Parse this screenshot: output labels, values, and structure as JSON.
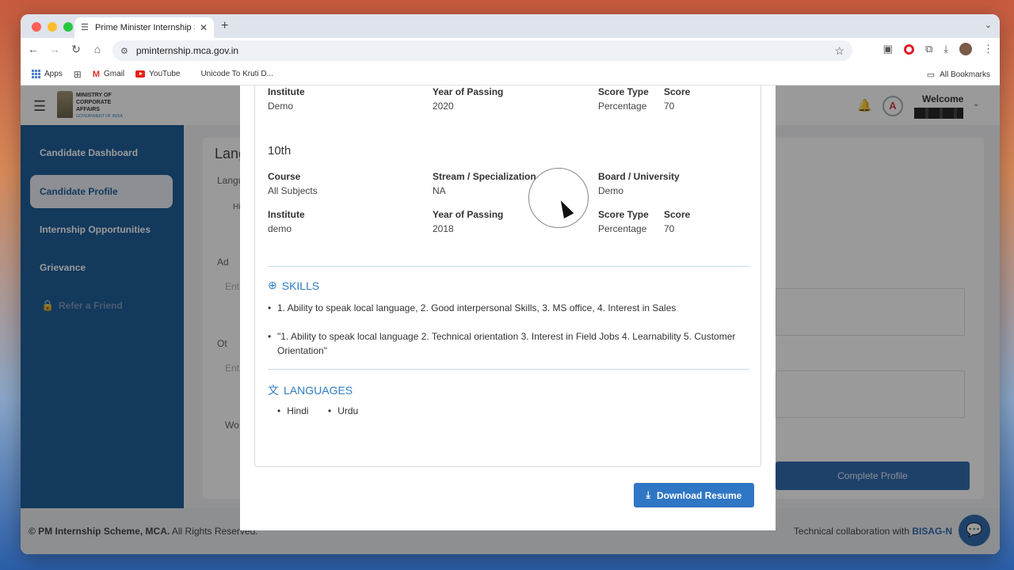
{
  "browser": {
    "tab_title": "Prime Minister Internship Sch",
    "new_tab": "+",
    "url": "pminternship.mca.gov.in",
    "bookmarks": [
      "Apps",
      "Gmail",
      "YouTube",
      "Unicode To Kruti D..."
    ],
    "all_bookmarks": "All Bookmarks"
  },
  "header": {
    "ministry_line1": "MINISTRY OF",
    "ministry_line2": "CORPORATE",
    "ministry_line3": "AFFAIRS",
    "ministry_sub": "GOVERNMENT OF INDIA",
    "welcome": "Welcome"
  },
  "sidebar": {
    "items": [
      {
        "label": "Candidate Dashboard"
      },
      {
        "label": "Candidate Profile"
      },
      {
        "label": "Internship Opportunities"
      },
      {
        "label": "Grievance"
      },
      {
        "label": "Refer a Friend"
      }
    ]
  },
  "background": {
    "lang_heading_frag": "Lang",
    "lang_label_frag": "Langu",
    "hi_frag": "Hi",
    "add_frag": "Ad",
    "enter_frag1": "Ent",
    "other_frag": "Ot",
    "enter_frag2": "Ent",
    "wo_frag": "Wo",
    "complete_profile": "Complete Profile"
  },
  "modal": {
    "edu12": {
      "institute_label": "Institute",
      "institute": "Demo",
      "year_label": "Year of Passing",
      "year": "2020",
      "score_type_label": "Score Type",
      "score_type": "Percentage",
      "score_label": "Score",
      "score": "70"
    },
    "edu10": {
      "title": "10th",
      "course_label": "Course",
      "course": "All Subjects",
      "stream_label": "Stream / Specialization",
      "stream": "NA",
      "board_label": "Board / University",
      "board": "Demo",
      "institute_label": "Institute",
      "institute": "demo",
      "year_label": "Year of Passing",
      "year": "2018",
      "score_type_label": "Score Type",
      "score_type": "Percentage",
      "score_label": "Score",
      "score": "70"
    },
    "skills": {
      "title": "SKILLS",
      "items": [
        "1. Ability to speak local language, 2. Good interpersonal Skills, 3. MS office, 4. Interest in Sales",
        "\"1. Ability to speak local language 2. Technical orientation 3. Interest in Field Jobs 4. Learnability 5. Customer Orientation\""
      ]
    },
    "languages": {
      "title": "LANGUAGES",
      "items": [
        "Hindi",
        "Urdu"
      ]
    },
    "download_label": "Download Resume"
  },
  "footer": {
    "brand": "© PM Internship Scheme, MCA.",
    "rights": " All Rights Reserved.",
    "collab": "Technical collaboration with ",
    "collab_org": "BISAG-N"
  }
}
